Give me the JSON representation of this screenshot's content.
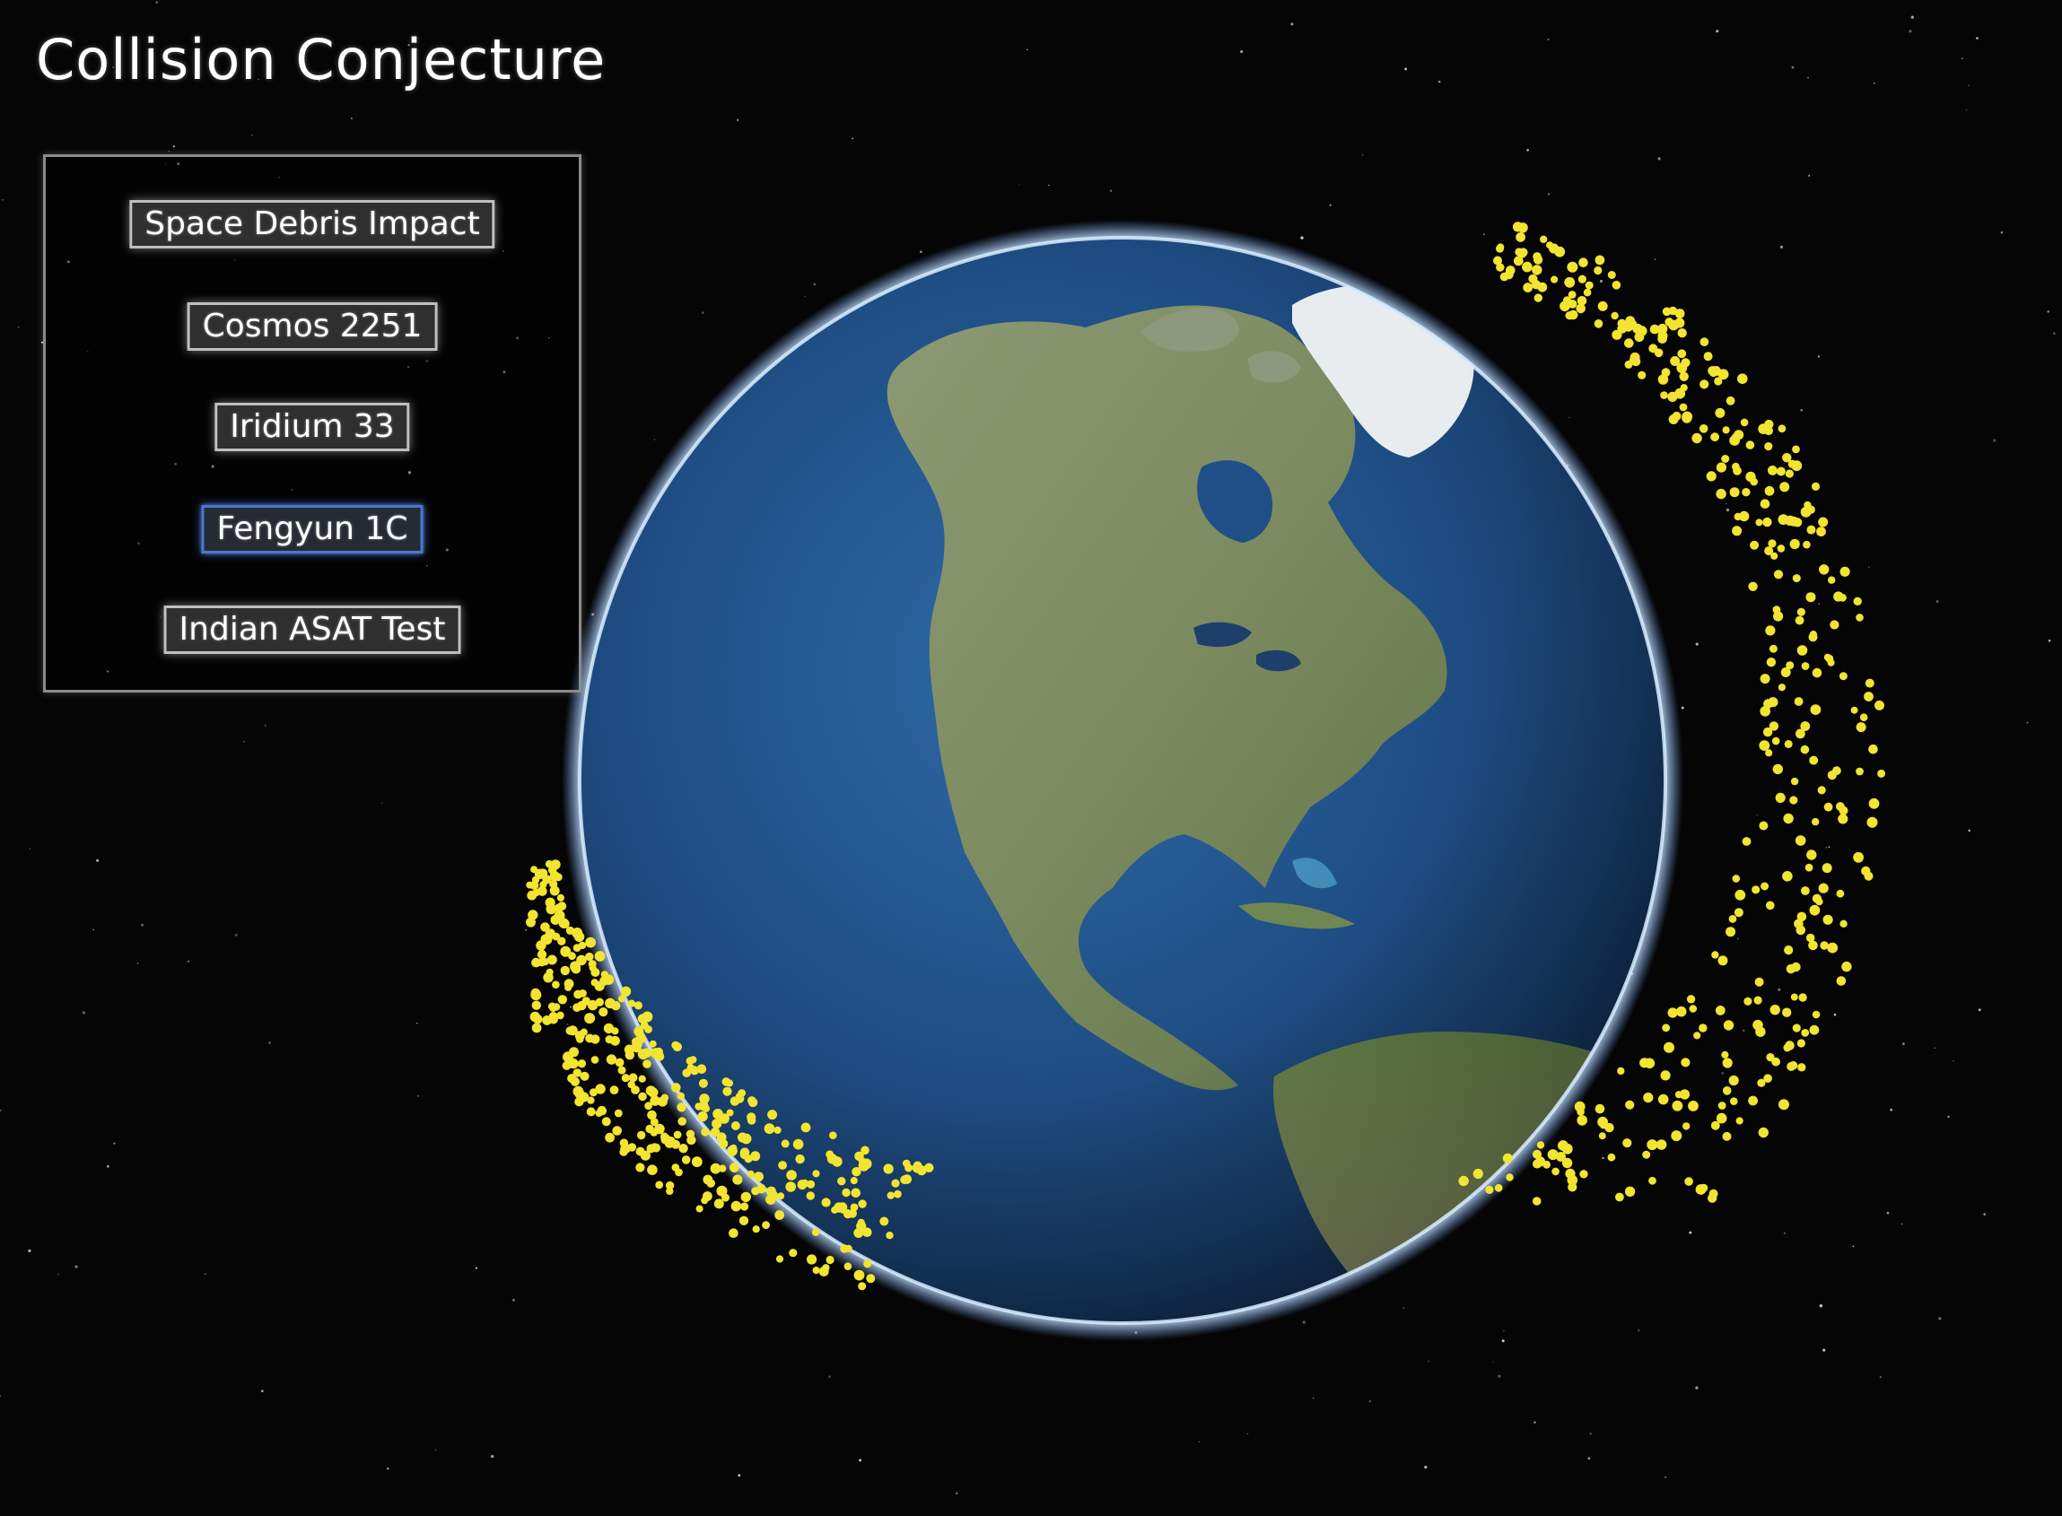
{
  "app": {
    "title": "Collision Conjecture"
  },
  "menu": {
    "items": [
      {
        "label": "Space Debris Impact",
        "selected": false
      },
      {
        "label": "Cosmos 2251",
        "selected": false
      },
      {
        "label": "Iridium 33",
        "selected": false
      },
      {
        "label": "Fengyun 1C",
        "selected": true
      },
      {
        "label": "Indian ASAT Test",
        "selected": false
      }
    ]
  },
  "scene": {
    "globe_view": "north-america",
    "debris_color": "#f2e430",
    "selection_color": "#4a74d9"
  }
}
